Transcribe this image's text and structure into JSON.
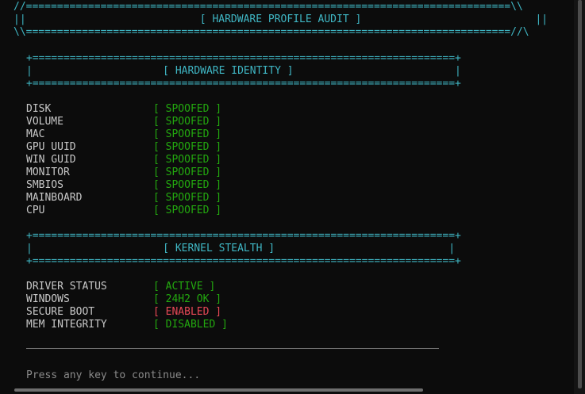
{
  "banner": {
    "top": "//==============================================================================\\\\",
    "middle": "||                            [ HARDWARE PROFILE AUDIT ]                            ||",
    "bottom": "\\\\==============================================================================//\\"
  },
  "section_hardware": {
    "border": "+====================================================================+",
    "title_line": "|                     [ HARDWARE IDENTITY ]                          |"
  },
  "hardware_rows": [
    {
      "label": "DISK",
      "status": "SPOOFED"
    },
    {
      "label": "VOLUME",
      "status": "SPOOFED"
    },
    {
      "label": "MAC",
      "status": "SPOOFED"
    },
    {
      "label": "GPU UUID",
      "status": "SPOOFED"
    },
    {
      "label": "WIN GUID",
      "status": "SPOOFED"
    },
    {
      "label": "MONITOR",
      "status": "SPOOFED"
    },
    {
      "label": "SMBIOS",
      "status": "SPOOFED"
    },
    {
      "label": "MAINBOARD",
      "status": "SPOOFED"
    },
    {
      "label": "CPU",
      "status": "SPOOFED"
    }
  ],
  "section_kernel": {
    "border": "+====================================================================+",
    "title_line": "|                     [ KERNEL STEALTH ]                            |"
  },
  "kernel_rows": [
    {
      "label": "DRIVER STATUS",
      "status": "ACTIVE",
      "color": "#23a80f"
    },
    {
      "label": "WINDOWS",
      "status": "24H2 OK",
      "color": "#23a80f"
    },
    {
      "label": "SECURE BOOT",
      "status": "ENABLED",
      "color": "#e74856"
    },
    {
      "label": "MEM INTEGRITY",
      "status": "DISABLED",
      "color": "#23a80f"
    }
  ],
  "prompt": "Press any key to continue..."
}
